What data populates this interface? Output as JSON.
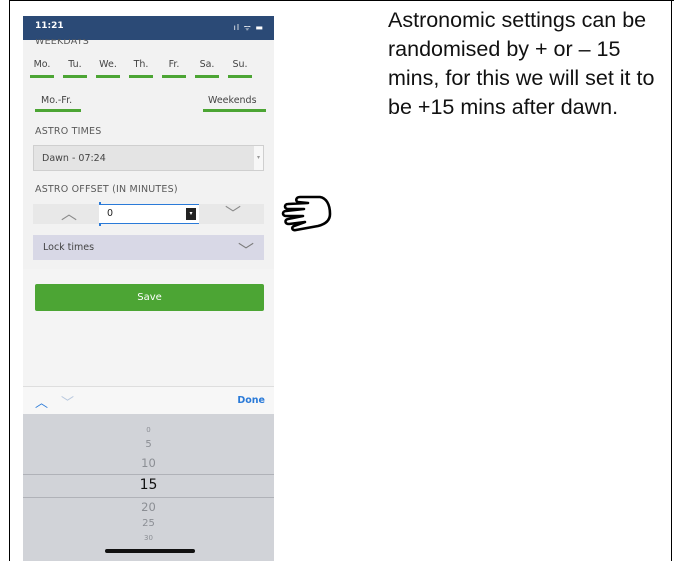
{
  "status": {
    "time": "11:21",
    "icons": "ıl ᯤ ▬"
  },
  "weekdays": {
    "label": "WEEKDAYS",
    "days": [
      "Mo.",
      "Tu.",
      "We.",
      "Th.",
      "Fr.",
      "Sa.",
      "Su."
    ],
    "group_left": "Mo.-Fr.",
    "group_right": "Weekends"
  },
  "astro_times": {
    "label": "ASTRO TIMES",
    "value": "Dawn - 07:24"
  },
  "astro_offset": {
    "label": "ASTRO OFFSET (IN MINUTES)",
    "value": "0"
  },
  "lock": {
    "label": "Lock times"
  },
  "save_label": "Save",
  "toolbar": {
    "done_label": "Done"
  },
  "picker": {
    "items_above": [
      "0",
      "5",
      "10"
    ],
    "selected": "15",
    "items_below": [
      "20",
      "25",
      "30"
    ]
  },
  "explanation": "Astronomic settings can be randomised by + or – 15 mins, for this we will set it to be +15 mins after dawn."
}
